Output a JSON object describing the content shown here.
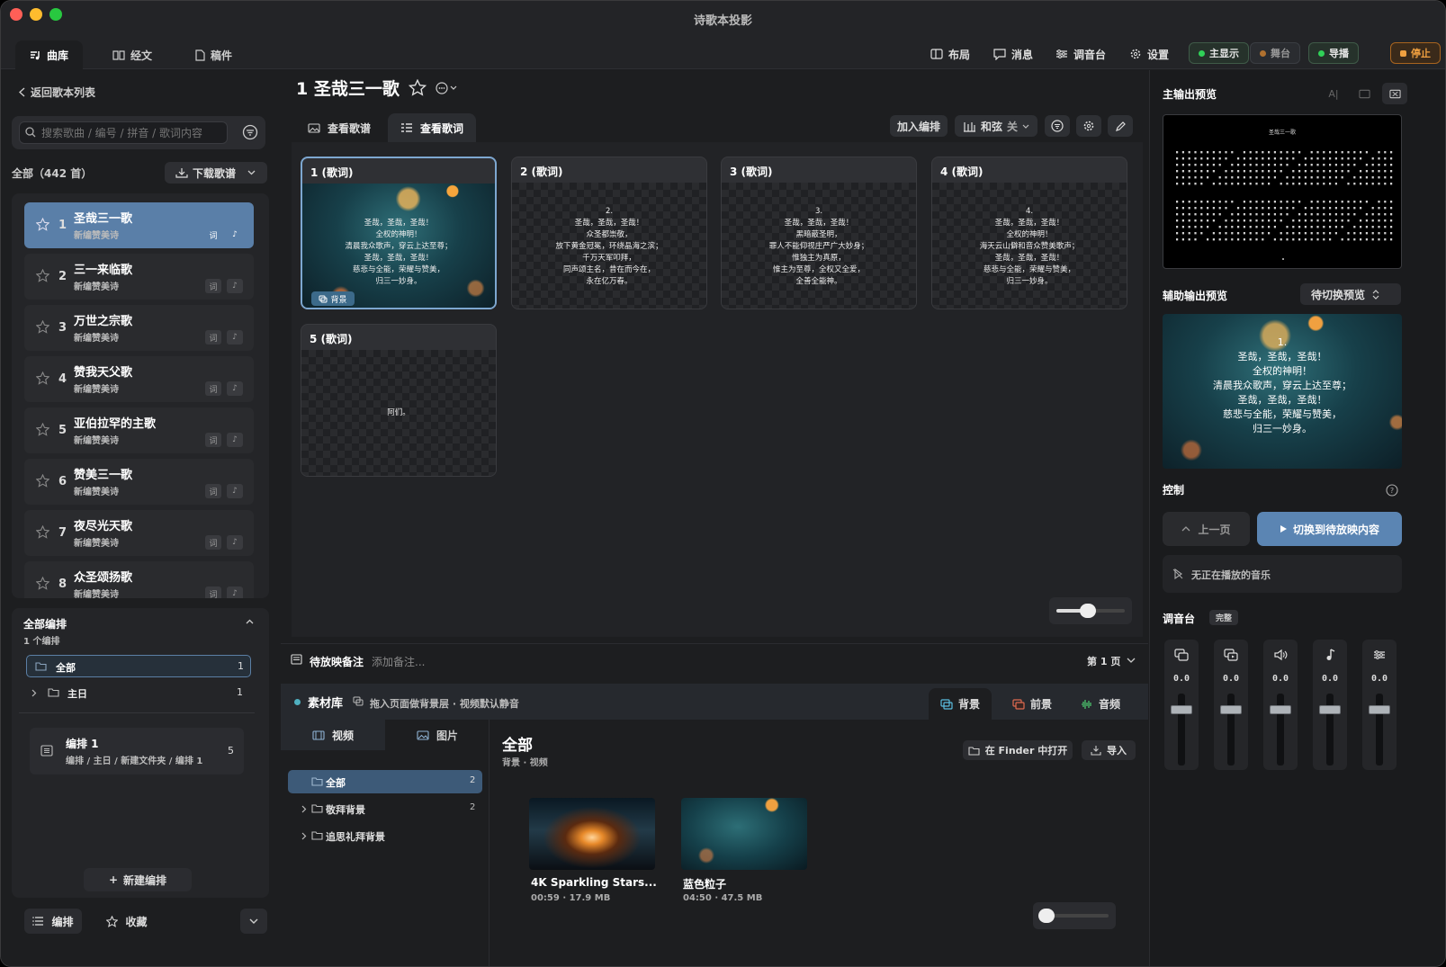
{
  "window": {
    "title": "诗歌本投影"
  },
  "top_tabs": [
    {
      "label": "曲库",
      "icon": "music-list-icon"
    },
    {
      "label": "经文",
      "icon": "book-icon"
    },
    {
      "label": "稿件",
      "icon": "document-icon"
    }
  ],
  "toolbar": {
    "layout": "布局",
    "messages": "消息",
    "mixer": "调音台",
    "settings": "设置",
    "main_display": "主显示",
    "stage": "舞台",
    "broadcast": "导播",
    "stop": "停止"
  },
  "sidebar": {
    "back": "返回歌本列表",
    "search_placeholder": "搜索歌曲 / 编号 / 拼音 / 歌词内容",
    "count": "全部（442 首）",
    "download": "下载歌谱",
    "songs": [
      {
        "num": "1",
        "name": "圣哉三一歌",
        "sub": "新编赞美诗",
        "badge1": "词",
        "badge2": "♪"
      },
      {
        "num": "2",
        "name": "三一来临歌",
        "sub": "新编赞美诗",
        "badge1": "词",
        "badge2": "♪"
      },
      {
        "num": "3",
        "name": "万世之宗歌",
        "sub": "新编赞美诗",
        "badge1": "词",
        "badge2": "♪"
      },
      {
        "num": "4",
        "name": "赞我天父歌",
        "sub": "新编赞美诗",
        "badge1": "词",
        "badge2": "♪"
      },
      {
        "num": "5",
        "name": "亚伯拉罕的主歌",
        "sub": "新编赞美诗",
        "badge1": "词",
        "badge2": "♪"
      },
      {
        "num": "6",
        "name": "赞美三一歌",
        "sub": "新编赞美诗",
        "badge1": "词",
        "badge2": "♪"
      },
      {
        "num": "7",
        "name": "夜尽光天歌",
        "sub": "新编赞美诗",
        "badge1": "词",
        "badge2": "♪"
      },
      {
        "num": "8",
        "name": "众圣颂扬歌",
        "sub": "新编赞美诗",
        "badge1": "词",
        "badge2": "♪"
      }
    ],
    "plans": {
      "title": "全部编排",
      "count": "1 个编排",
      "all": "全部",
      "all_count": "1",
      "sunday": "主日",
      "sunday_count": "1",
      "plan1_title": "编排 1",
      "plan1_path": "编排 / 主日 / 新建文件夹 / 编排 1",
      "plan1_count": "5",
      "new_plan": "新建编排"
    },
    "bottom": {
      "plans": "编排",
      "favorites": "收藏"
    }
  },
  "center": {
    "song_title": "1 圣哉三一歌",
    "view_tabs": [
      "查看歌谱",
      "查看歌词"
    ],
    "add_to_plan": "加入编排",
    "chords": "和弦",
    "chords_state": "关",
    "cards": [
      {
        "label": "1 (歌词)",
        "text": "圣哉，圣哉，圣哉！\n全权的神明！\n清晨我众歌声，穿云上达至尊；\n圣哉，圣哉，圣哉！\n慈悲与全能，荣耀与赞美，\n归三一妙身。",
        "badge": "背景"
      },
      {
        "label": "2 (歌词)",
        "text": "2.\n圣哉，圣哉，圣哉！\n众圣都崇敬，\n放下黄金冠冕，环绕晶海之滨；\n千万天军叩拜，\n同声颂主名，昔在而今在，\n永在亿万春。"
      },
      {
        "label": "3 (歌词)",
        "text": "3.\n圣哉，圣哉，圣哉！\n黑暗蔽圣明，\n罪人不能仰视庄严广大妙身；\n惟独主为真原，\n惟主为至尊，全权又全爱，\n全善全能神。"
      },
      {
        "label": "4 (歌词)",
        "text": "4.\n圣哉，圣哉，圣哉！\n全权的神明！\n海天云山僻和音众赞美歌声；\n圣哉，圣哉，圣哉！\n慈悲与全能，荣耀与赞美，\n归三一妙身。"
      },
      {
        "label": "5 (歌词)",
        "text": "阿们。"
      }
    ],
    "notes_label": "待放映备注",
    "notes_placeholder": "添加备注...",
    "page": "第 1 页",
    "library": {
      "title": "素材库",
      "hint": "拖入页面做背景层 · 视频默认静音",
      "tabs": [
        "背景",
        "前景",
        "音频"
      ],
      "media_tabs": [
        "视频",
        "图片"
      ],
      "folders": [
        {
          "name": "全部",
          "count": "2"
        },
        {
          "name": "敬拜背景",
          "count": "2"
        },
        {
          "name": "追思礼拜背景",
          "count": ""
        }
      ],
      "heading": "全部",
      "subheading": "背景 · 视频",
      "open_finder": "在 Finder 中打开",
      "import": "导入",
      "items": [
        {
          "name": "4K Sparkling Stars...",
          "meta": "00:59 · 17.9 MB"
        },
        {
          "name": "蓝色粒子",
          "meta": "04:50 · 47.5 MB"
        }
      ]
    }
  },
  "right": {
    "main_preview": "主输出预览",
    "main_preview_title": "圣哉三一歌",
    "aux_preview": "辅助输出预览",
    "aux_select": "待切换预览",
    "aux_text": "1.\n圣哉，圣哉，圣哉！\n全权的神明！\n清晨我众歌声，穿云上达至尊；\n圣哉，圣哉，圣哉！\n慈悲与全能，荣耀与赞美，\n归三一妙身。",
    "control": "控制",
    "prev": "上一页",
    "switch": "切换到待放映内容",
    "no_music": "无正在播放的音乐",
    "mixer": "调音台",
    "mixer_mode": "完整",
    "channels": [
      {
        "icon": "layers-icon",
        "value": "0.0"
      },
      {
        "icon": "media-icon",
        "value": "0.0"
      },
      {
        "icon": "speaker-icon",
        "value": "0.0"
      },
      {
        "icon": "music-note-icon",
        "value": "0.0"
      },
      {
        "icon": "sliders-icon",
        "value": "0.0"
      }
    ]
  }
}
